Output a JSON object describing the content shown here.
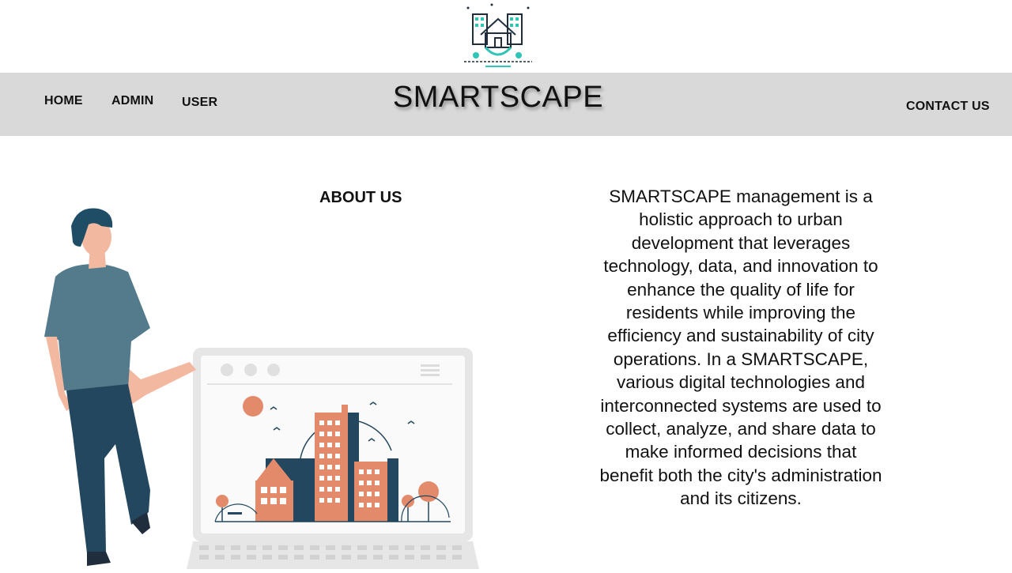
{
  "header": {
    "logo_icon": "smart-city-house-gear-icon"
  },
  "nav": {
    "home": "HOME",
    "admin": "ADMIN",
    "user": "USER",
    "brand": "SMARTSCAPE",
    "contact": "CONTACT US"
  },
  "about": {
    "title": "ABOUT US",
    "text": "SMARTSCAPE management is a holistic approach to urban development that leverages technology, data, and innovation to enhance the quality of life for residents while improving the efficiency and sustainability of city operations. In a SMARTSCAPE, various digital technologies and interconnected systems are used to collect, analyze, and share data to make informed decisions that benefit both the city's administration and its citizens."
  },
  "illustration": {
    "name": "person-with-laptop-city-illustration"
  },
  "colors": {
    "navbar_bg": "#d9d9d9",
    "accent_teal": "#2ec4b6",
    "navy": "#22475e",
    "orange": "#e28a6a"
  }
}
